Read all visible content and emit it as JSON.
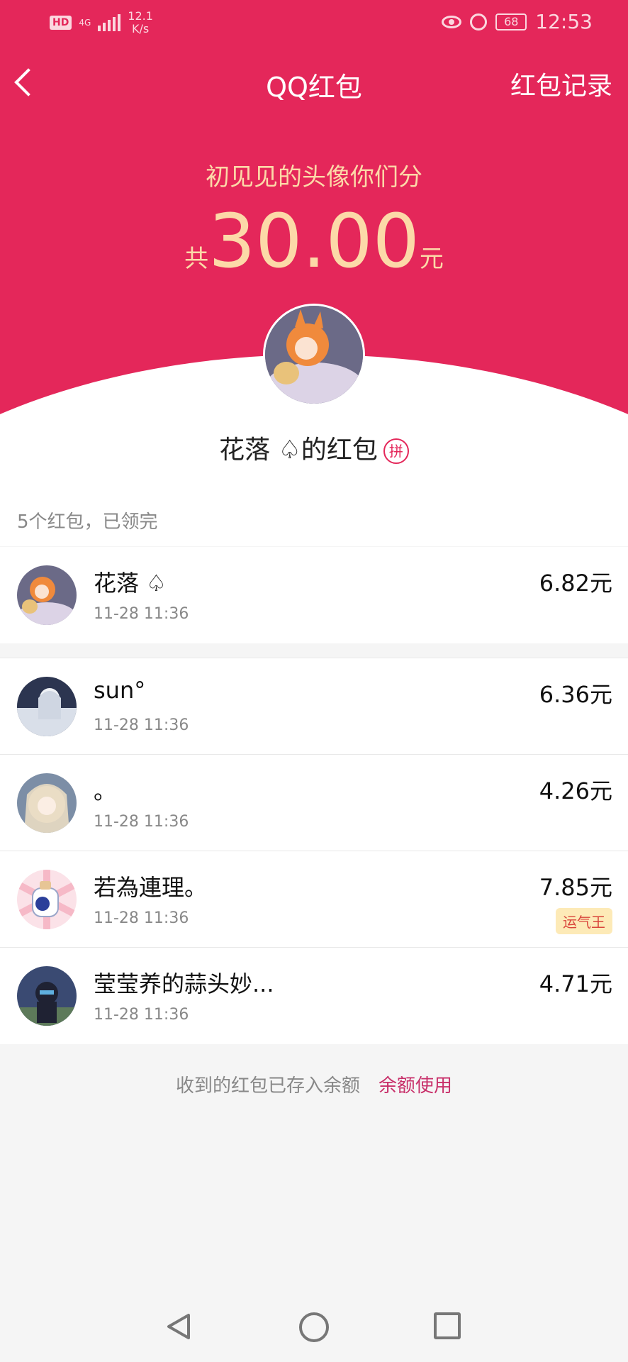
{
  "status_bar": {
    "hd": "HD",
    "network": "4G",
    "speed_value": "12.1",
    "speed_unit": "K/s",
    "battery": "68",
    "time": "12:53"
  },
  "nav": {
    "title": "QQ红包",
    "right_label": "红包记录"
  },
  "packet": {
    "message": "初见见的头像你们分",
    "amount_prefix": "共",
    "amount": "30.00",
    "amount_suffix": "元",
    "sender_label": "花落 ♤的红包",
    "badge": "拼"
  },
  "summary": {
    "count_text": "5个红包，已领完"
  },
  "receivers": [
    {
      "name": "花落 ♤",
      "time": "11-28 11:36",
      "amount": "6.82元"
    },
    {
      "name": "sun°",
      "time": "11-28 11:36",
      "amount": "6.36元"
    },
    {
      "name": "。",
      "time": "11-28 11:36",
      "amount": "4.26元"
    },
    {
      "name": "若為連理。",
      "time": "11-28 11:36",
      "amount": "7.85元",
      "badge": "运气王"
    },
    {
      "name": "莹莹养的蒜头妙...",
      "time": "11-28 11:36",
      "amount": "4.71元"
    }
  ],
  "footer": {
    "text": "收到的红包已存入余额",
    "link": "余额使用"
  },
  "colors": {
    "header": "#e4275a",
    "gold": "#fcd9a8",
    "link": "#c8306a",
    "luck_badge_bg": "#fdeab7"
  }
}
